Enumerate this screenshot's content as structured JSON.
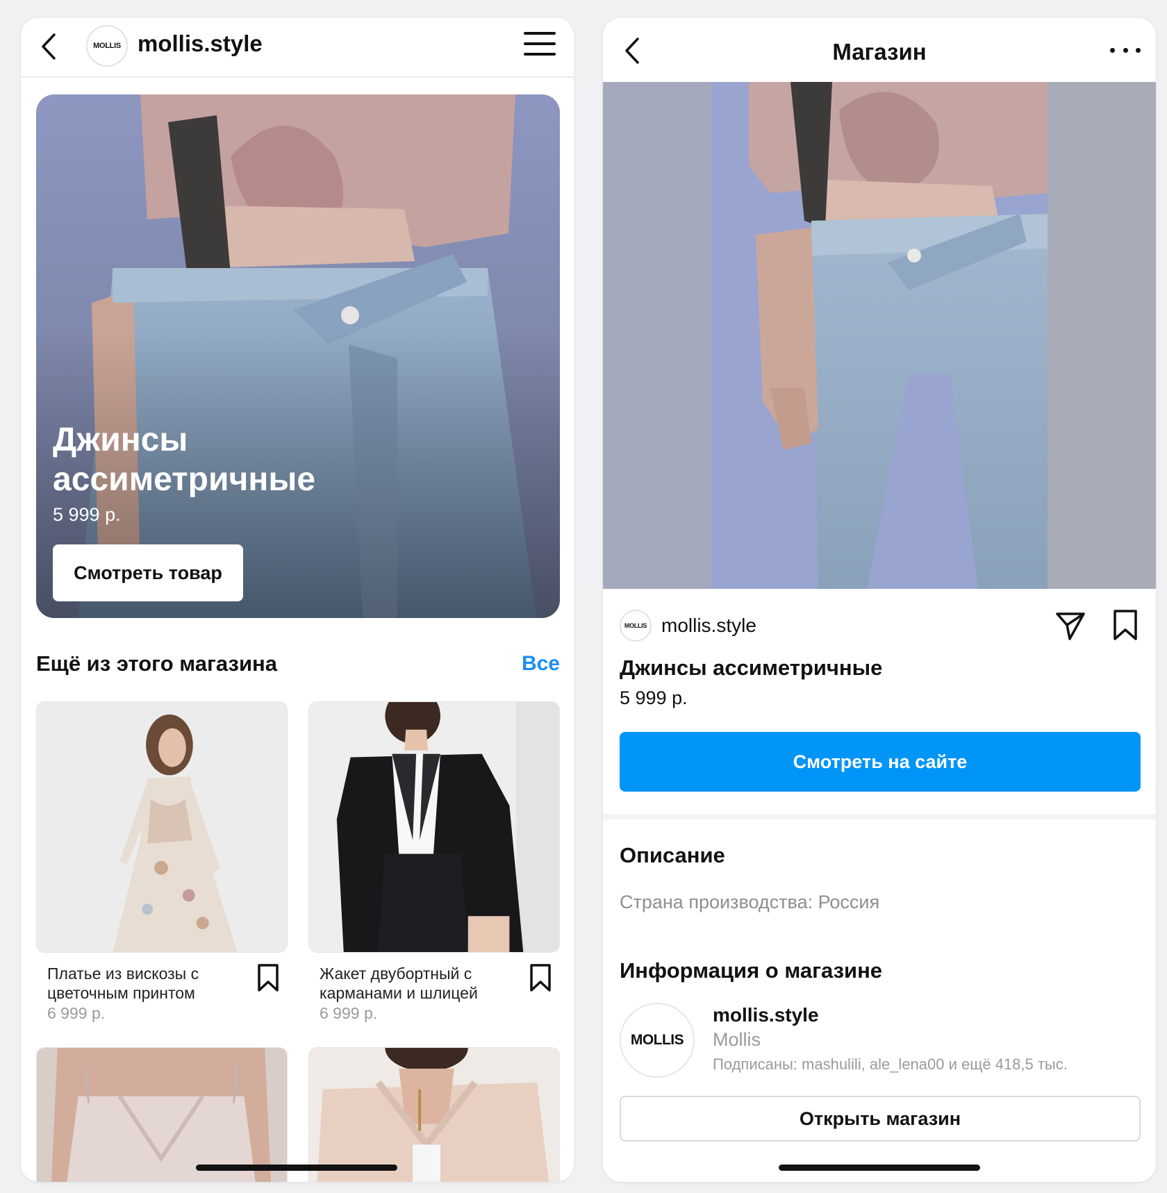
{
  "left": {
    "header": {
      "logo_text": "MOLLIS",
      "username": "mollis.style"
    },
    "hero": {
      "title": "Джинсы ассиметричные",
      "price": "5 999 р.",
      "button_label": "Смотреть товар"
    },
    "section": {
      "title": "Ещё из этого магазина",
      "all_link": "Все"
    },
    "products": [
      {
        "title": "Платье из вискозы с цветочным принтом",
        "price": "6 999 р."
      },
      {
        "title": "Жакет двубортный с карманами и шлицей",
        "price": "6 999 р."
      }
    ]
  },
  "right": {
    "header": {
      "title": "Магазин"
    },
    "shop_row": {
      "logo_text": "MOLLIS",
      "username": "mollis.style"
    },
    "product": {
      "title": "Джинсы ассиметричные",
      "price": "5 999 р.",
      "site_button_label": "Смотреть на сайте"
    },
    "description": {
      "heading": "Описание",
      "text": "Страна производства: Россия"
    },
    "shop_info": {
      "heading": "Информация о магазине",
      "logo_text": "MOLLIS",
      "username": "mollis.style",
      "full_name": "Mollis",
      "followers": "Подписаны: mashulili, ale_lena00 и ещё 418,5 тыс.",
      "open_button_label": "Открыть магазин"
    }
  },
  "colors": {
    "accent_blue": "#0095f6",
    "link_blue": "#1a8ef5",
    "muted_text": "#8e8e8e"
  },
  "icons": [
    "back-icon",
    "menu-icon",
    "more-icon",
    "bookmark-icon",
    "share-icon"
  ]
}
